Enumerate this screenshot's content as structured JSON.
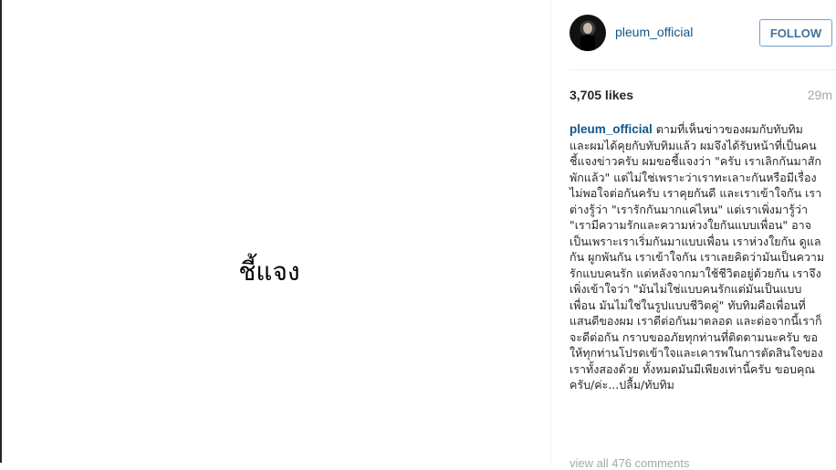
{
  "photo": {
    "text": "ชี้แจง"
  },
  "header": {
    "username": "pleum_official",
    "follow_label": "FOLLOW"
  },
  "stats": {
    "likes": "3,705 likes",
    "time": "29m"
  },
  "caption": {
    "username": "pleum_official",
    "text": "ตามที่เห็นข่าวของผมกับทับทิม และผมได้คุยกับทับทิมแล้ว ผมจึงได้รับหน้าที่เป็นคนชี้แจงข่าวครับ ผมขอชี้แจงว่า \"ครับ เราเลิกกันมาสักพักแล้ว\" แต่ไม่ใช่เพราะว่าเราทะเลาะกันหรือมีเรื่องไม่พอใจต่อกันครับ เราคุยกันดี และเราเข้าใจกัน เราต่างรู้ว่า \"เรารักกันมากแค่ไหน\" แต่เราเพิ่งมารู้ว่า \"เรามีความรักและความห่วงใยกันแบบเพื่อน\" อาจเป็นเพราะเราเริ่มกันมาแบบเพื่อน เราห่วงใยกัน ดูแลกัน ผูกพันกัน เราเข้าใจกัน เราเลยคิดว่ามันเป็นความรักแบบคนรัก แต่หลังจากมาใช้ชีวิตอยู่ด้วยกัน เราจึงเพิ่งเข้าใจว่า \"มันไม่ใช่แบบคนรักแต่มันเป็นแบบเพื่อน มันไม่ใช่ในรูปแบบชีวิตคู่\" ทับทิมคือเพื่อนที่แสนดีของผม เราดีต่อกันมาตลอด และต่อจากนี้เราก็จะดีต่อกัน กราบขออภัยทุกท่านที่ติดตามนะครับ ขอให้ทุกท่านโปรดเข้าใจและเคารพในการตัดสินใจของเราทั้งสองด้วย ทั้งหมดมันมีเพียงเท่านี้ครับ ขอบคุณครับ/ค่ะ...ปลื้ม/ทับทิม"
  },
  "comments": {
    "view_all": "view all 476 comments"
  }
}
